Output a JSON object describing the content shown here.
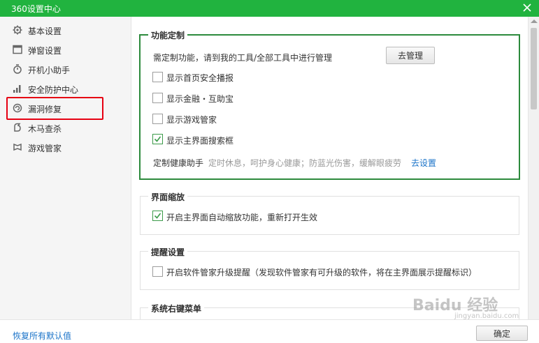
{
  "window": {
    "title": "360设置中心"
  },
  "sidebar": {
    "items": [
      {
        "label": "基本设置",
        "icon": "gear-icon"
      },
      {
        "label": "弹窗设置",
        "icon": "window-icon"
      },
      {
        "label": "开机小助手",
        "icon": "timer-icon"
      },
      {
        "label": "安全防护中心",
        "icon": "signal-bars-icon"
      },
      {
        "label": "漏洞修复",
        "icon": "repair-icon"
      },
      {
        "label": "木马查杀",
        "icon": "trojan-icon"
      },
      {
        "label": "游戏管家",
        "icon": "gamepad-icon"
      }
    ]
  },
  "sections": {
    "feature_custom": {
      "title": "功能定制",
      "hint": "需定制功能，请到我的工具/全部工具中进行管理",
      "manage_button": "去管理",
      "options": [
        {
          "label": "显示首页安全播报",
          "checked": false
        },
        {
          "label": "显示金融・互助宝",
          "checked": false
        },
        {
          "label": "显示游戏管家",
          "checked": false
        },
        {
          "label": "显示主界面搜索框",
          "checked": true
        }
      ],
      "health": {
        "label": "定制健康助手",
        "desc": "定时休息，呵护身心健康；防蓝光伤害，缓解眼疲劳",
        "link": "去设置"
      }
    },
    "zoom": {
      "title": "界面缩放",
      "option": {
        "label": "开启主界面自动缩放功能，重新打开生效",
        "checked": true
      }
    },
    "reminder": {
      "title": "提醒设置",
      "option": {
        "label": "开启软件管家升级提醒（发现软件管家有可升级的软件，将在主界面展示提醒标识）",
        "checked": false
      }
    },
    "context_menu": {
      "title": "系统右键菜单"
    }
  },
  "footer": {
    "restore_link": "恢复所有默认值",
    "ok_button": "确定"
  },
  "watermark": {
    "main": "Baidu 经验",
    "sub": "jingyan.baidu.com"
  },
  "colors": {
    "titlebar": "#21b33f",
    "active_border": "#2c8a3c",
    "highlight": "#e60012",
    "link": "#1a73c8"
  }
}
